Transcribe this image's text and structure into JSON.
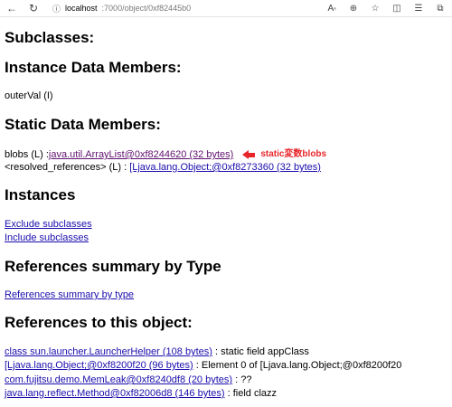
{
  "browser": {
    "url_host": "localhost",
    "url_path": ":7000/object/0xf82445b0"
  },
  "sections": {
    "subclasses": "Subclasses:",
    "instance_members": "Instance Data Members:",
    "outer_val": "outerVal (I)",
    "static_members": "Static Data Members:",
    "blobs_label": "blobs (L) : ",
    "blobs_link": "java.util.ArrayList@0xf8244620 (32 bytes)",
    "resolved_label": "<resolved_references> (L) : ",
    "resolved_link": "[Ljava.lang.Object;@0xf8273360 (32 bytes)",
    "instances": "Instances",
    "exclude_subclasses": "Exclude subclasses",
    "include_subclasses": "Include subclasses",
    "ref_summary_heading": "References summary by Type",
    "ref_summary_link": "References summary by type",
    "refs_to_object": "References to this object:"
  },
  "annotation": {
    "text": "static変数blobs",
    "color": "#e8262a"
  },
  "references": [
    {
      "link": "class sun.launcher.LauncherHelper (108 bytes)",
      "suffix": " : static field appClass"
    },
    {
      "link": "[Ljava.lang.Object;@0xf8200f20 (96 bytes)",
      "suffix": " : Element 0 of [Ljava.lang.Object;@0xf8200f20"
    },
    {
      "link": "com.fujitsu.demo.MemLeak@0xf8240df8 (20 bytes)",
      "suffix": " : ??"
    },
    {
      "link": "java.lang.reflect.Method@0xf82006d8 (146 bytes)",
      "suffix": " : field clazz"
    }
  ]
}
